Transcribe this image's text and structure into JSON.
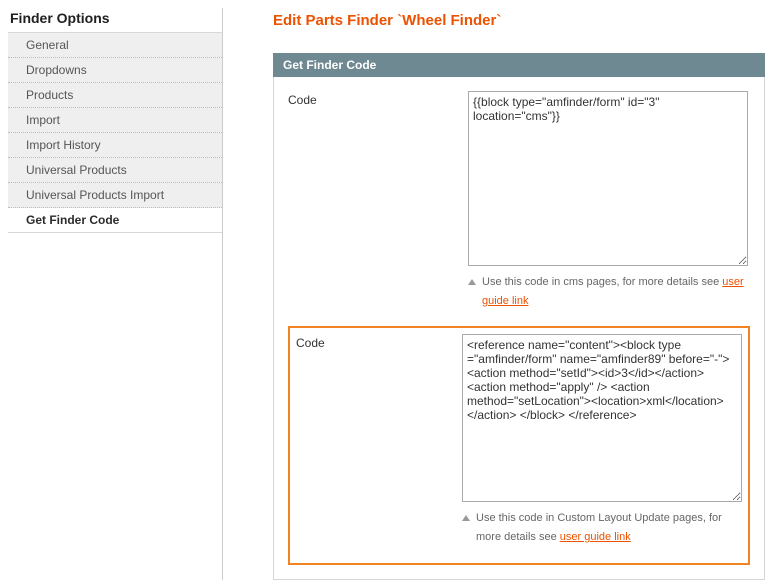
{
  "sidebar": {
    "title": "Finder Options",
    "items": [
      {
        "label": "General"
      },
      {
        "label": "Dropdowns"
      },
      {
        "label": "Products"
      },
      {
        "label": "Import"
      },
      {
        "label": "Import History"
      },
      {
        "label": "Universal Products"
      },
      {
        "label": "Universal Products Import"
      },
      {
        "label": "Get Finder Code"
      }
    ],
    "active_index": 7
  },
  "page_title": "Edit Parts Finder `Wheel Finder`",
  "section": {
    "header": "Get Finder Code",
    "fields": [
      {
        "label": "Code",
        "value": "{{block type=\"amfinder/form\" id=\"3\" location=\"cms\"}}",
        "hint_prefix": "Use this code in cms pages, for more details see ",
        "hint_link": "user guide link"
      },
      {
        "label": "Code",
        "value": "<reference name=\"content\"><block type =\"amfinder/form\" name=\"amfinder89\" before=\"-\"> <action method=\"setId\"><id>3</id></action> <action method=\"apply\" /> <action method=\"setLocation\"><location>xml</location></action> </block> </reference>",
        "hint_prefix": "Use this code in Custom Layout Update pages, for more details see ",
        "hint_link": "user guide link"
      }
    ]
  }
}
